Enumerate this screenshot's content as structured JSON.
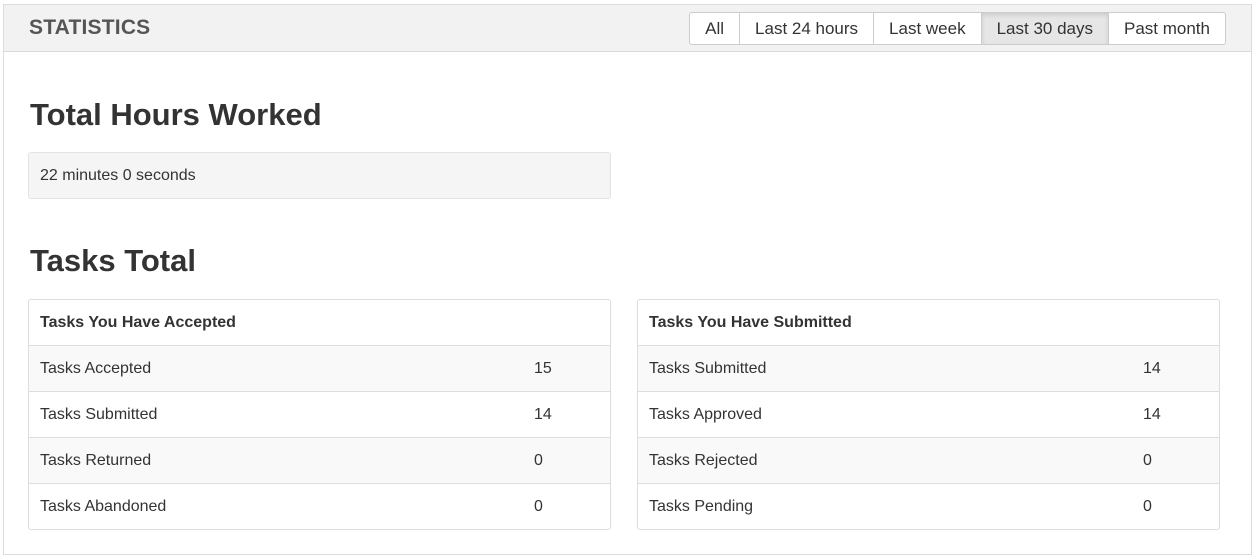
{
  "header": {
    "title": "STATISTICS",
    "filters": [
      {
        "label": "All",
        "active": false
      },
      {
        "label": "Last 24 hours",
        "active": false
      },
      {
        "label": "Last week",
        "active": false
      },
      {
        "label": "Last 30 days",
        "active": true
      },
      {
        "label": "Past month",
        "active": false
      }
    ]
  },
  "hours": {
    "heading": "Total Hours Worked",
    "value": "22 minutes 0 seconds"
  },
  "tasks": {
    "heading": "Tasks Total",
    "accepted": {
      "title": "Tasks You Have Accepted",
      "rows": [
        {
          "label": "Tasks Accepted",
          "value": "15"
        },
        {
          "label": "Tasks Submitted",
          "value": "14"
        },
        {
          "label": "Tasks Returned",
          "value": "0"
        },
        {
          "label": "Tasks Abandoned",
          "value": "0"
        }
      ]
    },
    "submitted": {
      "title": "Tasks You Have Submitted",
      "rows": [
        {
          "label": "Tasks Submitted",
          "value": "14"
        },
        {
          "label": "Tasks Approved",
          "value": "14"
        },
        {
          "label": "Tasks Rejected",
          "value": "0"
        },
        {
          "label": "Tasks Pending",
          "value": "0"
        }
      ]
    }
  }
}
